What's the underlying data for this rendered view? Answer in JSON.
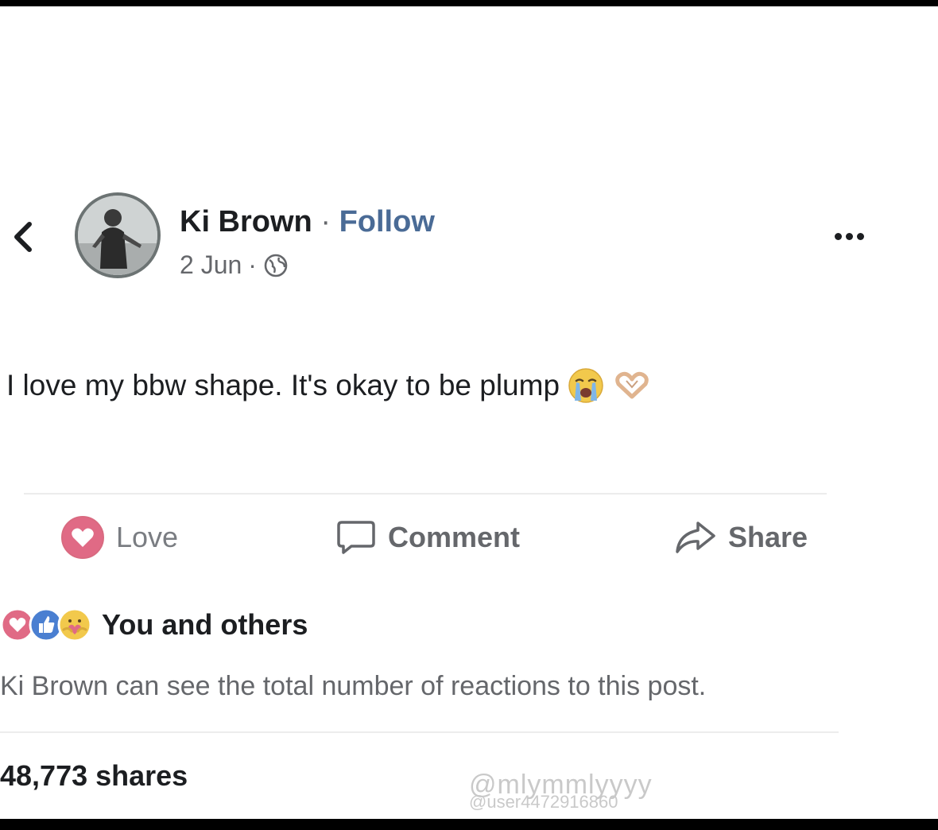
{
  "post": {
    "author": "Ki Brown",
    "separator": "·",
    "follow_label": "Follow",
    "date": "2 Jun",
    "date_separator": "·",
    "text": "I love my bbw shape. It's okay to be plump",
    "emojis": [
      "loudly-crying-face",
      "heart-hands"
    ]
  },
  "actions": {
    "love": "Love",
    "comment": "Comment",
    "share": "Share"
  },
  "reactions": {
    "icons": [
      "love-reaction-icon",
      "like-reaction-icon",
      "care-reaction-icon"
    ],
    "label": "You and others",
    "notice": "Ki Brown can see the total number of reactions to this post."
  },
  "shares": "48,773 shares",
  "watermark": {
    "handle": "@mlymmlyyyy",
    "user": "@user4472916860"
  },
  "colors": {
    "follow": "#4a6b96",
    "love": "#e06a85",
    "like": "#4a7fd1",
    "muted_text": "#65676b"
  }
}
